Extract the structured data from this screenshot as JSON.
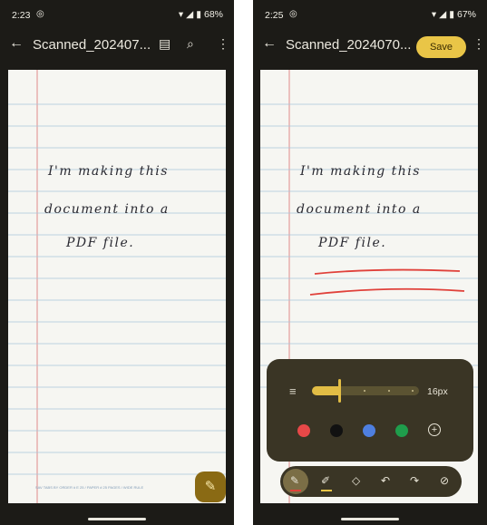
{
  "left": {
    "status": {
      "time": "2:23",
      "battery": "68%"
    },
    "title": "Scanned_202407...",
    "handwriting": [
      "I'm making this",
      "document into a",
      "PDF file."
    ],
    "footer_print": "SAV TABS BY ORDER # E 25 / PAPER # 25 PAGES / WIDE RULE"
  },
  "right": {
    "status": {
      "time": "2:25",
      "battery": "67%"
    },
    "title": "Scanned_2024070...",
    "save_label": "Save",
    "handwriting": [
      "I'm making this",
      "document into a",
      "PDF file."
    ],
    "panel": {
      "size_label": "16px",
      "slider_value_fraction": 0.25,
      "colors": [
        "#e74848",
        "#111111",
        "#4e7fe0",
        "#1f9d4c"
      ]
    },
    "toolbar": [
      "pen-icon",
      "highlighter-icon",
      "eraser-icon",
      "undo-icon",
      "redo-icon",
      "hide-icon"
    ],
    "accent": "#e9c547"
  },
  "icons": {
    "back": "←",
    "more": "⋮"
  }
}
